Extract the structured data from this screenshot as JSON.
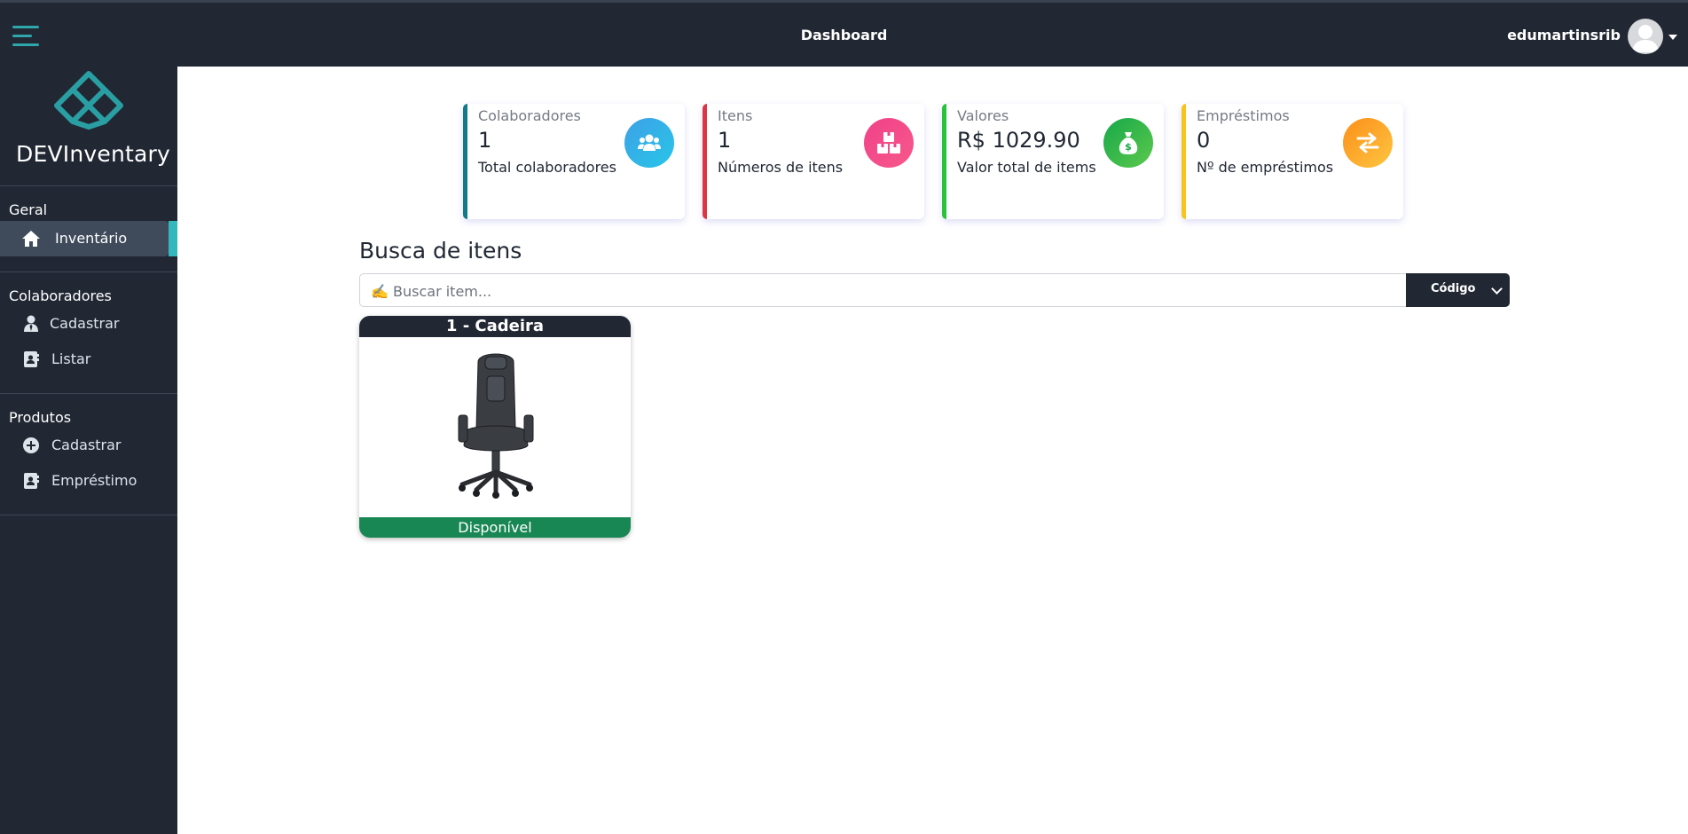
{
  "header": {
    "title": "Dashboard",
    "username": "edumartinsrib"
  },
  "sidebar": {
    "brand": "DEVInventary",
    "sections": [
      {
        "title": "Geral",
        "items": [
          {
            "label": "Inventário",
            "icon": "home-icon",
            "active": true
          }
        ]
      },
      {
        "title": "Colaboradores",
        "items": [
          {
            "label": "Cadastrar",
            "icon": "user-tie-icon"
          },
          {
            "label": "Listar",
            "icon": "address-book-icon"
          }
        ]
      },
      {
        "title": "Produtos",
        "items": [
          {
            "label": "Cadastrar",
            "icon": "plus-circle-icon"
          },
          {
            "label": "Empréstimo",
            "icon": "address-book-icon"
          }
        ]
      }
    ]
  },
  "stats": [
    {
      "title": "Colaboradores",
      "value": "1",
      "subtitle": "Total colaboradores",
      "color": "#117a8b",
      "icon": "users-icon"
    },
    {
      "title": "Itens",
      "value": "1",
      "subtitle": "Números de itens",
      "color": "#dc3545",
      "icon": "boxes-icon"
    },
    {
      "title": "Valores",
      "value": "R$ 1029.90",
      "subtitle": "Valor total de items",
      "color": "#28c33a",
      "icon": "money-bag-icon"
    },
    {
      "title": "Empréstimos",
      "value": "0",
      "subtitle": "Nº de empréstimos",
      "color": "#f7c41d",
      "icon": "exchange-icon"
    }
  ],
  "search": {
    "title": "Busca de itens",
    "placeholder": "✍️ Buscar item...",
    "filter_selected": "Código"
  },
  "items": [
    {
      "title": "1 - Cadeira",
      "status": "Disponível",
      "status_color": "#198754"
    }
  ]
}
